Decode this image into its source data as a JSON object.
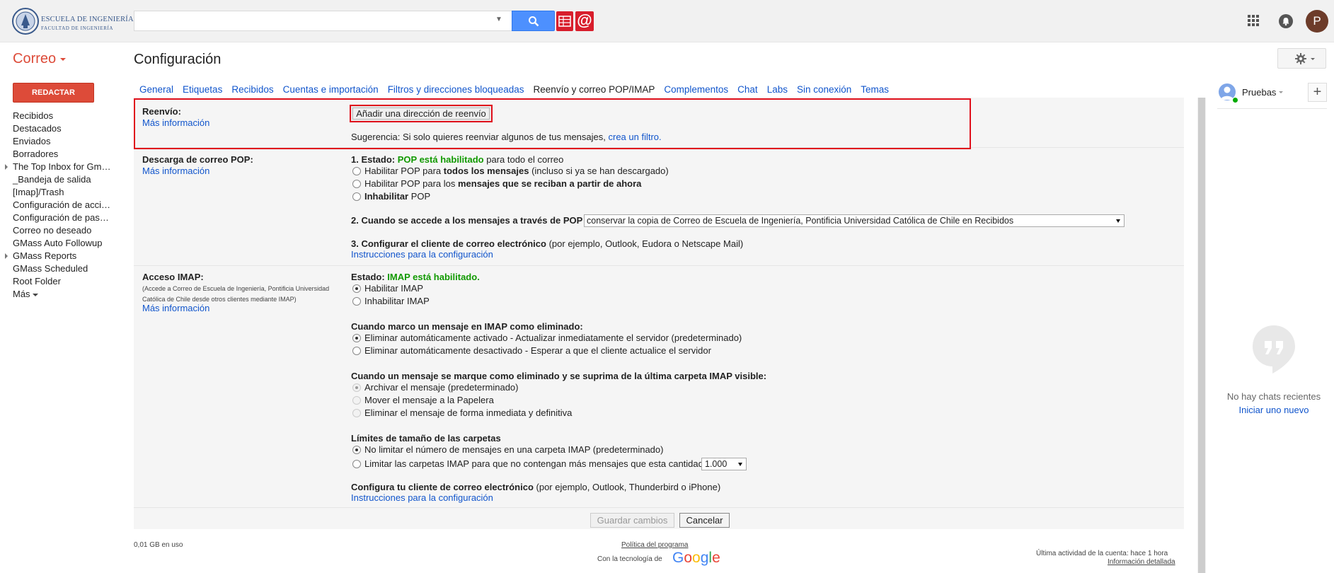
{
  "header": {
    "logo_line1": "ESCUELA DE INGENIERÍA",
    "logo_line2": "FACULTAD DE INGENIERÍA",
    "search_placeholder": "",
    "avatar_initial": "P",
    "icons": [
      "search-icon",
      "sheet-icon",
      "at-icon",
      "apps-icon",
      "notifications-icon",
      "settings-gear-icon"
    ]
  },
  "app_label": "Correo",
  "page_title": "Configuración",
  "compose_label": "REDACTAR",
  "nav": [
    {
      "label": "Recibidos",
      "expandable": false
    },
    {
      "label": "Destacados",
      "expandable": false
    },
    {
      "label": "Enviados",
      "expandable": false
    },
    {
      "label": "Borradores",
      "expandable": false
    },
    {
      "label": "The Top Inbox for Gm…",
      "expandable": true
    },
    {
      "label": "_Bandeja de salida",
      "expandable": false
    },
    {
      "label": "[Imap]/Trash",
      "expandable": false
    },
    {
      "label": "Configuración de acci…",
      "expandable": false
    },
    {
      "label": "Configuración de pas…",
      "expandable": false
    },
    {
      "label": "Correo no deseado",
      "expandable": false
    },
    {
      "label": "GMass Auto Followup",
      "expandable": false
    },
    {
      "label": "GMass Reports",
      "expandable": true
    },
    {
      "label": "GMass Scheduled",
      "expandable": false
    },
    {
      "label": "Root Folder",
      "expandable": false
    }
  ],
  "nav_more": "Más",
  "tabs": [
    {
      "label": "General",
      "selected": false
    },
    {
      "label": "Etiquetas",
      "selected": false
    },
    {
      "label": "Recibidos",
      "selected": false
    },
    {
      "label": "Cuentas e importación",
      "selected": false
    },
    {
      "label": "Filtros y direcciones bloqueadas",
      "selected": false
    },
    {
      "label": "Reenvío y correo POP/IMAP",
      "selected": true
    },
    {
      "label": "Complementos",
      "selected": false
    },
    {
      "label": "Chat",
      "selected": false
    },
    {
      "label": "Labs",
      "selected": false
    },
    {
      "label": "Sin conexión",
      "selected": false
    },
    {
      "label": "Temas",
      "selected": false
    }
  ],
  "forwarding": {
    "label": "Reenvío:",
    "more_info": "Más información",
    "add_button": "Añadir una dirección de reenvío",
    "tip_prefix": "Sugerencia: Si solo quieres reenviar algunos de tus mensajes,",
    "tip_link": "crea un filtro."
  },
  "pop": {
    "label": "Descarga de correo POP:",
    "more_info": "Más información",
    "status_prefix": "1. Estado:",
    "status_value": "POP está habilitado",
    "status_suffix": "para todo el correo",
    "opt1_a": "Habilitar POP para",
    "opt1_b": "todos los mensajes",
    "opt1_c": "(incluso si ya se han descargado)",
    "opt2_a": "Habilitar POP para los",
    "opt2_b": "mensajes que se reciban a partir de ahora",
    "opt3_a": "Inhabilitar",
    "opt3_b": "POP",
    "access_label": "2. Cuando se accede a los mensajes a través de POP",
    "access_value": "conservar la copia de Correo de Escuela de Ingeniería, Pontificia Universidad Católica de Chile en Recibidos",
    "config_label": "3. Configurar el cliente de correo electrónico",
    "config_suffix": "(por ejemplo, Outlook, Eudora o Netscape Mail)",
    "config_link": "Instrucciones para la configuración"
  },
  "imap": {
    "label": "Acceso IMAP:",
    "desc1": "(Accede a Correo de Escuela de Ingeniería, Pontificia Universidad",
    "desc2": "Católica de Chile desde otros clientes mediante IMAP)",
    "more_info": "Más información",
    "status_prefix": "Estado:",
    "status_value": "IMAP está habilitado.",
    "enable": "Habilitar IMAP",
    "disable": "Inhabilitar IMAP",
    "deleted_title": "Cuando marco un mensaje en IMAP como eliminado:",
    "auto_on": "Eliminar automáticamente activado - Actualizar inmediatamente el servidor (predeterminado)",
    "auto_off": "Eliminar automáticamente desactivado - Esperar a que el cliente actualice el servidor",
    "expunge_title": "Cuando un mensaje se marque como eliminado y se suprima de la última carpeta IMAP visible:",
    "archive": "Archivar el mensaje (predeterminado)",
    "trash": "Mover el mensaje a la Papelera",
    "delete_forever": "Eliminar el mensaje de forma inmediata y definitiva",
    "limits_title": "Límites de tamaño de las carpetas",
    "no_limit": "No limitar el número de mensajes en una carpeta IMAP (predeterminado)",
    "limit": "Limitar las carpetas IMAP para que no contengan más mensajes que esta cantidad",
    "limit_value": "1.000",
    "client_title": "Configura tu cliente de correo electrónico",
    "client_suffix": "(por ejemplo, Outlook, Thunderbird o iPhone)",
    "client_link": "Instrucciones para la configuración"
  },
  "buttons": {
    "save": "Guardar cambios",
    "cancel": "Cancelar"
  },
  "footer": {
    "usage": "0,01 GB en uso",
    "policy": "Política del programa",
    "powered": "Con la tecnología de",
    "google": "Google",
    "activity": "Última actividad de la cuenta: hace 1 hora",
    "details": "Información detallada"
  },
  "chat": {
    "user": "Pruebas",
    "plus": "+",
    "empty": "No hay chats recientes",
    "start": "Iniciar uno nuevo"
  },
  "colors": {
    "accent_red": "#dd4b39",
    "link": "#1155cc",
    "search_blue": "#4d90fe",
    "status_green": "#119900",
    "highlight_red": "#e0101c"
  }
}
